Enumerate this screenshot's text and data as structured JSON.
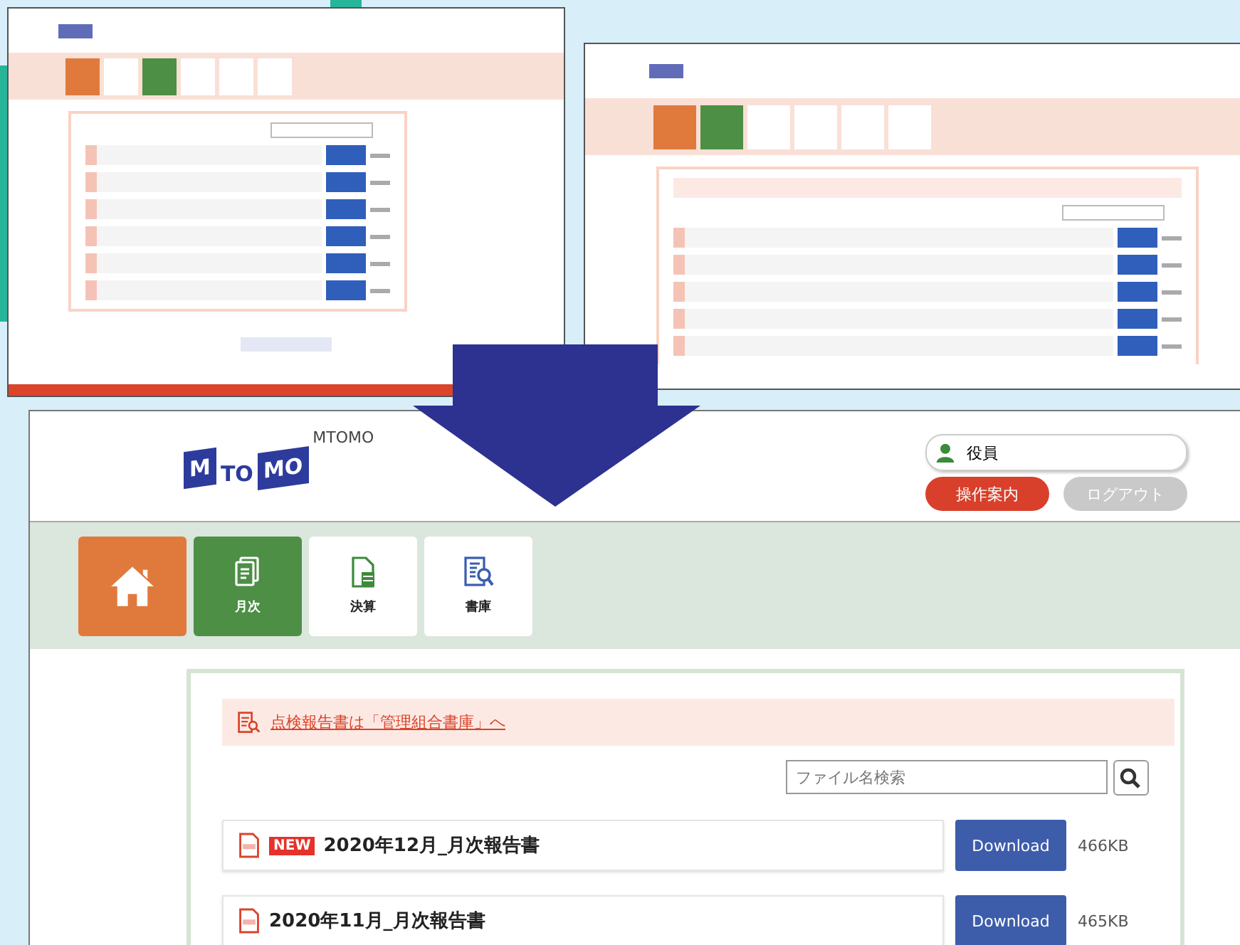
{
  "thumbnails": [
    {
      "kind": "annual"
    },
    {
      "kind": "monthly"
    }
  ],
  "main": {
    "logo": {
      "parts": [
        "M",
        "TO",
        "MO"
      ],
      "caption": "MTOMO"
    },
    "user": {
      "role": "役員"
    },
    "header_buttons": [
      {
        "label": "操作案内",
        "disabled": false
      },
      {
        "label": "ログアウト",
        "disabled": true
      }
    ],
    "nav": [
      {
        "kind": "home",
        "selected": false
      },
      {
        "kind": "monthly",
        "label": "月次",
        "selected": true
      },
      {
        "kind": "settlement",
        "label": "決算",
        "selected": false
      },
      {
        "kind": "library",
        "label": "書庫",
        "selected": false
      }
    ],
    "notice": {
      "text": "点検報告書は「管理組合書庫」へ"
    },
    "search": {
      "placeholder": "ファイル名検索"
    },
    "files": [
      {
        "new_badge": "NEW",
        "name": "2020年12月_月次報告書",
        "button": "Download",
        "size": "466KB"
      },
      {
        "name": "2020年11月_月次報告書",
        "button": "Download",
        "size": "465KB"
      }
    ]
  }
}
